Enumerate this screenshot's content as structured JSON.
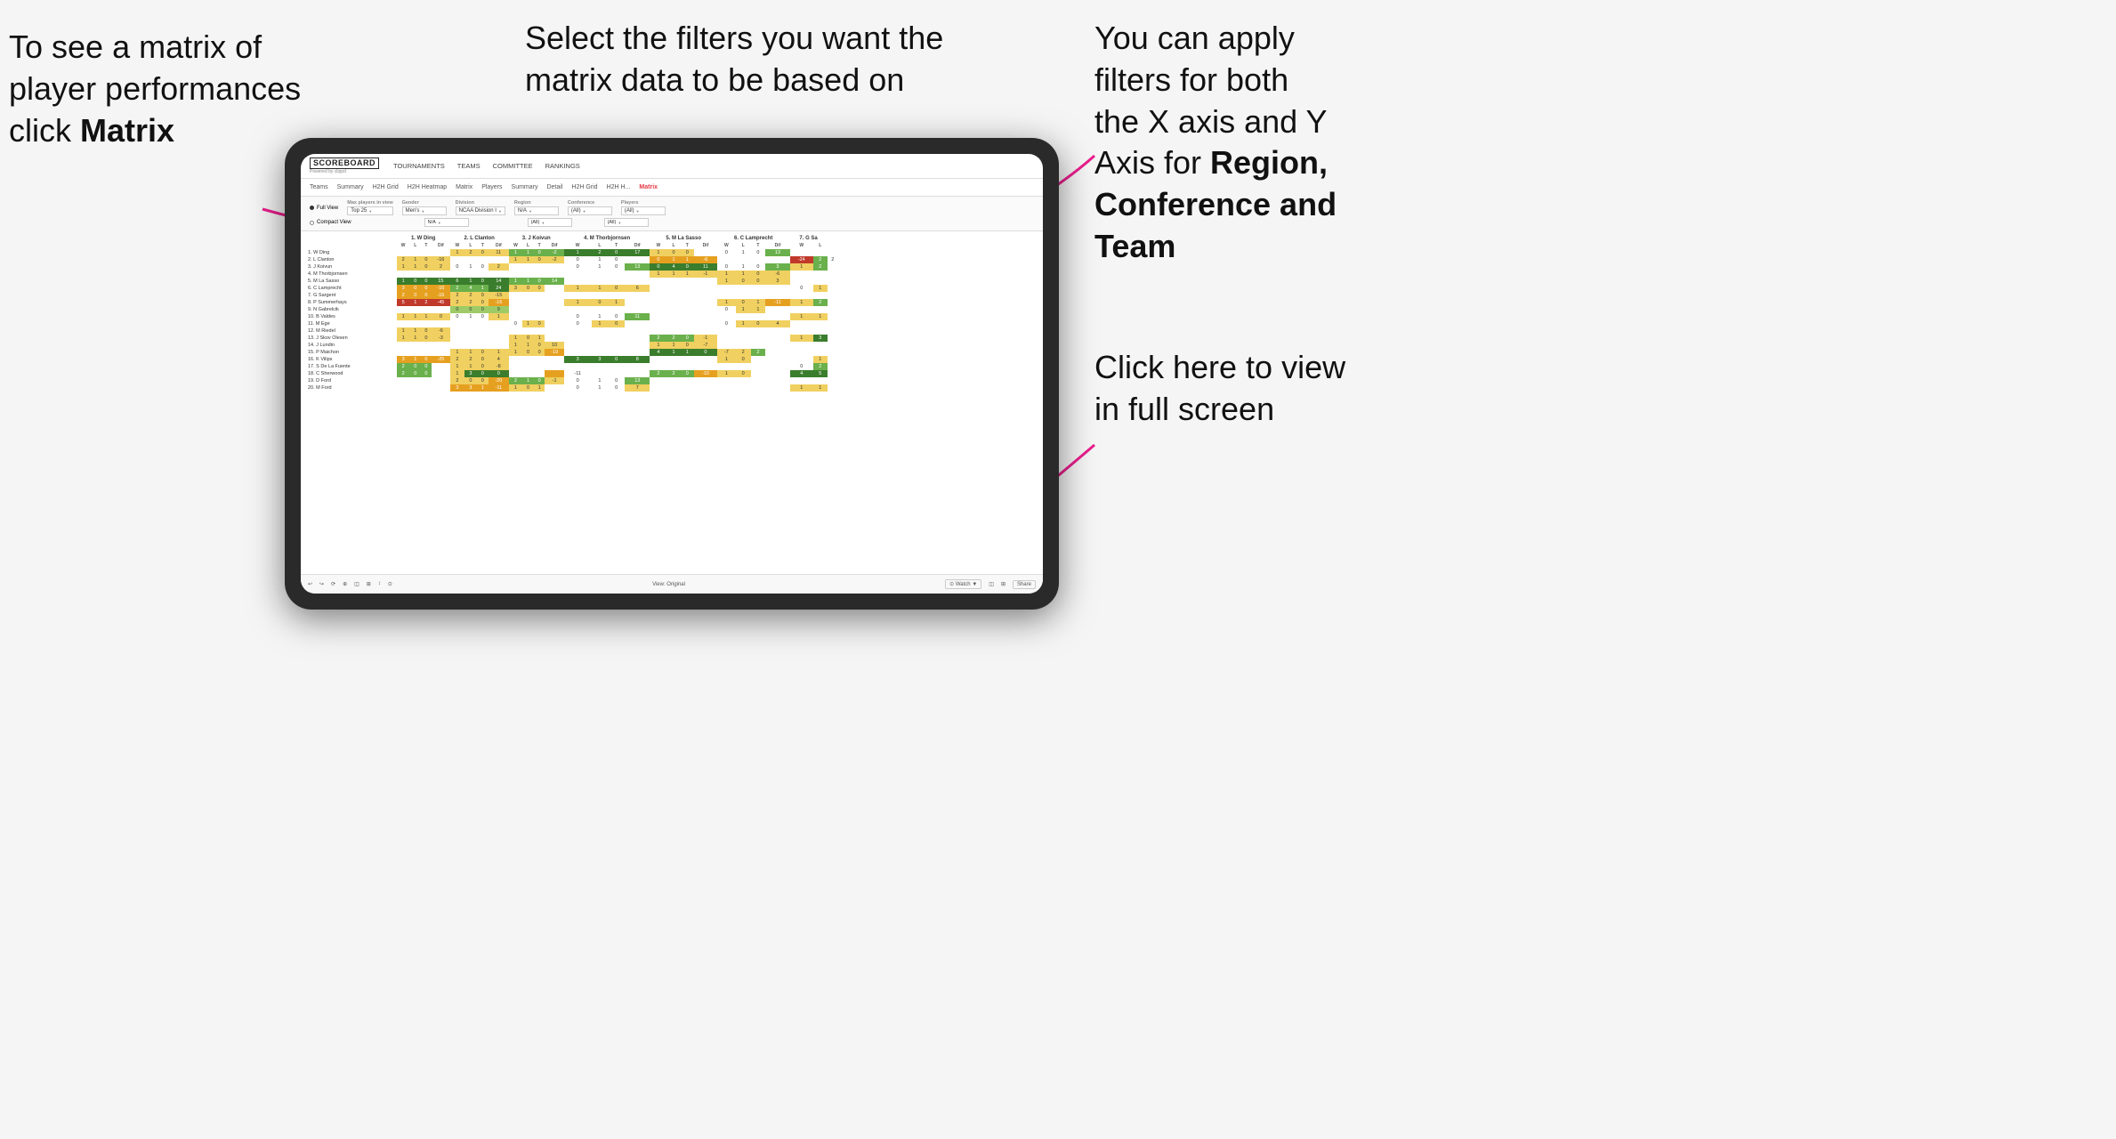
{
  "annotations": {
    "topleft": {
      "line1": "To see a matrix of",
      "line2": "player performances",
      "line3prefix": "click ",
      "line3bold": "Matrix"
    },
    "topcenter": {
      "text": "Select the filters you want the matrix data to be based on"
    },
    "topright": {
      "line1": "You  can apply",
      "line2": "filters for both",
      "line3": "the X axis and Y",
      "line4prefix": "Axis for ",
      "line4bold": "Region,",
      "line5bold": "Conference and",
      "line6bold": "Team"
    },
    "bottomright": {
      "line1": "Click here to view",
      "line2": "in full screen"
    }
  },
  "app": {
    "logo": "SCOREBOARD",
    "logo_sub": "Powered by clippd",
    "nav": [
      "TOURNAMENTS",
      "TEAMS",
      "COMMITTEE",
      "RANKINGS"
    ],
    "subnav": [
      "Teams",
      "Summary",
      "H2H Grid",
      "H2H Heatmap",
      "Matrix",
      "Players",
      "Summary",
      "Detail",
      "H2H Grid",
      "H2H H...",
      "Matrix"
    ],
    "active_subnav": "Matrix"
  },
  "filters": {
    "view_options": [
      "Full View",
      "Compact View"
    ],
    "selected_view": "Full View",
    "groups": [
      {
        "label": "Max players in view",
        "value": "Top 25"
      },
      {
        "label": "Gender",
        "value": "Men's"
      },
      {
        "label": "Division",
        "value": "NCAA Division I"
      },
      {
        "label": "Region",
        "value": "N/A",
        "value2": "N/A"
      },
      {
        "label": "Conference",
        "value": "(All)",
        "value2": "(All)"
      },
      {
        "label": "Players",
        "value": "(All)",
        "value2": "(All)"
      }
    ]
  },
  "matrix": {
    "col_headers": [
      "1. W Ding",
      "2. L Clanton",
      "3. J Koivun",
      "4. M Thorbjornsen",
      "5. M La Sasso",
      "6. C Lamprecht",
      "7. G Sa"
    ],
    "sub_cols": [
      "W",
      "L",
      "T",
      "Dif"
    ],
    "rows": [
      {
        "name": "1. W Ding",
        "cells": [
          "",
          "",
          "",
          "",
          "1",
          "2",
          "0",
          "11",
          "1",
          "1",
          "0",
          "-2",
          "1",
          "2",
          "0",
          "17",
          "1",
          "0",
          "0",
          "",
          "0",
          "1",
          "0",
          "13"
        ]
      },
      {
        "name": "2. L Clanton",
        "cells": [
          "2",
          "1",
          "0",
          "-16",
          "",
          "",
          "",
          "",
          "1",
          "1",
          "0",
          "-2",
          "0",
          "1",
          "0",
          "",
          "0",
          "1",
          "1",
          "-6",
          "",
          "",
          "",
          "",
          "-24",
          "2",
          "2"
        ]
      },
      {
        "name": "3. J Koivun",
        "cells": [
          "1",
          "1",
          "0",
          "2",
          "0",
          "1",
          "0",
          "2",
          "",
          "",
          "",
          "",
          "0",
          "1",
          "0",
          "13",
          "0",
          "4",
          "0",
          "11",
          "0",
          "1",
          "0",
          "3",
          "1",
          "2"
        ]
      },
      {
        "name": "4. M Thorbjornsen",
        "cells": [
          "",
          "",
          "",
          "",
          "",
          "",
          "",
          "",
          "",
          "",
          "",
          "",
          "",
          "",
          "",
          "",
          "1",
          "1",
          "1",
          "-1",
          "1",
          "1",
          "0",
          "-6",
          "",
          "",
          ""
        ]
      },
      {
        "name": "5. M La Sasso",
        "cells": [
          "1",
          "0",
          "0",
          "15",
          "6",
          "1",
          "0",
          "14",
          "1",
          "1",
          "0",
          "14",
          "",
          "",
          "",
          "",
          "",
          "",
          "",
          "",
          "1",
          "0",
          "0",
          "3",
          "",
          "",
          ""
        ]
      },
      {
        "name": "6. C Lamprecht",
        "cells": [
          "3",
          "0",
          "0",
          "-16",
          "2",
          "4",
          "1",
          "24",
          "3",
          "0",
          "0",
          "",
          "1",
          "1",
          "0",
          "6",
          "",
          "",
          "",
          "",
          "",
          "",
          "",
          "",
          "0",
          "1"
        ]
      },
      {
        "name": "7. G Sargent",
        "cells": [
          "2",
          "0",
          "0",
          "-16",
          "2",
          "2",
          "0",
          "-15",
          "",
          "",
          "",
          "",
          "",
          "",
          "",
          "",
          "",
          "",
          "",
          "",
          "",
          "",
          "",
          "",
          "",
          "",
          ""
        ]
      },
      {
        "name": "8. P Summerhays",
        "cells": [
          "5",
          "1",
          "2",
          "-45",
          "2",
          "2",
          "0",
          "-16",
          "",
          "",
          "",
          "",
          "1",
          "0",
          "1",
          "",
          "",
          "",
          "",
          "",
          "1",
          "0",
          "1",
          "-11",
          "1",
          "2"
        ]
      },
      {
        "name": "9. N Gabrelcik",
        "cells": [
          "",
          "",
          "",
          "",
          "0",
          "0",
          "0",
          "9",
          "",
          "",
          "",
          "",
          "",
          "",
          "",
          "",
          "",
          "",
          "",
          "",
          "0",
          "1",
          "1",
          "",
          "",
          "",
          ""
        ]
      },
      {
        "name": "10. B Valdes",
        "cells": [
          "1",
          "1",
          "1",
          "0",
          "0",
          "1",
          "0",
          "1",
          "",
          "",
          "",
          "",
          "0",
          "1",
          "0",
          "11",
          "",
          "",
          "",
          "",
          "",
          "",
          "",
          "",
          "1",
          "1"
        ]
      },
      {
        "name": "11. M Ege",
        "cells": [
          "",
          "",
          "",
          "",
          "",
          "",
          "",
          "",
          "0",
          "1",
          "0",
          "",
          "0",
          "1",
          "0",
          "",
          "",
          "",
          "",
          "",
          "0",
          "1",
          "0",
          "4",
          "",
          "",
          ""
        ]
      },
      {
        "name": "12. M Riedel",
        "cells": [
          "1",
          "1",
          "0",
          "-6",
          "",
          "",
          "",
          "",
          "",
          "",
          "",
          "",
          "",
          "",
          "",
          "",
          "",
          "",
          "",
          "",
          "",
          "",
          "",
          "",
          "",
          "",
          ""
        ]
      },
      {
        "name": "13. J Skov Olesen",
        "cells": [
          "1",
          "1",
          "0",
          "-3",
          "",
          "",
          "",
          "",
          "1",
          "0",
          "1",
          "",
          "",
          "",
          "",
          "",
          "2",
          "2",
          "0",
          "-1",
          "",
          "",
          "",
          "",
          "1",
          "3"
        ]
      },
      {
        "name": "14. J Lundin",
        "cells": [
          "",
          "",
          "",
          "",
          "",
          "",
          "",
          "",
          "1",
          "1",
          "0",
          "10",
          "",
          "",
          "",
          "",
          "1",
          "1",
          "0",
          "-7",
          "",
          "",
          "",
          "",
          "",
          "",
          ""
        ]
      },
      {
        "name": "15. P Maichon",
        "cells": [
          "",
          "",
          "",
          "",
          "1",
          "1",
          "0",
          "1",
          "1",
          "0",
          "0",
          "-19",
          "",
          "",
          "",
          "",
          "4",
          "1",
          "1",
          "0",
          "-7",
          "2",
          "2"
        ]
      },
      {
        "name": "16. K Vilips",
        "cells": [
          "3",
          "1",
          "0",
          "-25",
          "2",
          "2",
          "0",
          "4",
          "",
          "",
          "",
          "",
          "3",
          "3",
          "0",
          "8",
          "",
          "",
          "",
          "",
          "1",
          "0",
          "",
          "",
          "",
          "1"
        ]
      },
      {
        "name": "17. S De La Fuente",
        "cells": [
          "2",
          "0",
          "0",
          "",
          "1",
          "1",
          "0",
          "-8",
          "",
          "",
          "",
          "",
          "",
          "",
          "",
          "",
          "",
          "",
          "",
          "",
          "",
          "",
          "",
          "",
          "0",
          "2"
        ]
      },
      {
        "name": "18. C Sherwood",
        "cells": [
          "2",
          "0",
          "0",
          "",
          "1",
          "3",
          "0",
          "0",
          "",
          "",
          "",
          "",
          "-11",
          "",
          "",
          "",
          "2",
          "2",
          "0",
          "-10",
          "1",
          "0",
          "",
          "",
          "4",
          "5"
        ]
      },
      {
        "name": "19. D Ford",
        "cells": [
          "",
          "",
          "",
          "",
          "2",
          "0",
          "0",
          "-20",
          "2",
          "1",
          "0",
          "-1",
          "0",
          "1",
          "0",
          "13",
          "",
          "",
          "",
          "",
          "",
          "",
          "",
          "",
          "",
          "",
          ""
        ]
      },
      {
        "name": "20. M Ford",
        "cells": [
          "",
          "",
          "",
          "",
          "3",
          "3",
          "1",
          "-11",
          "1",
          "0",
          "1",
          "",
          "0",
          "1",
          "0",
          "7",
          "",
          "",
          "",
          "",
          "",
          "",
          "",
          "",
          "1",
          "1"
        ]
      }
    ]
  },
  "bottom_bar": {
    "left_icons": [
      "↩",
      "↪",
      "⟳",
      "⊕",
      "◫",
      "⊞",
      "↕",
      "⊙"
    ],
    "center": "View: Original",
    "right": [
      "⊙ Watch ▼",
      "◫",
      "⊞",
      "Share"
    ]
  }
}
